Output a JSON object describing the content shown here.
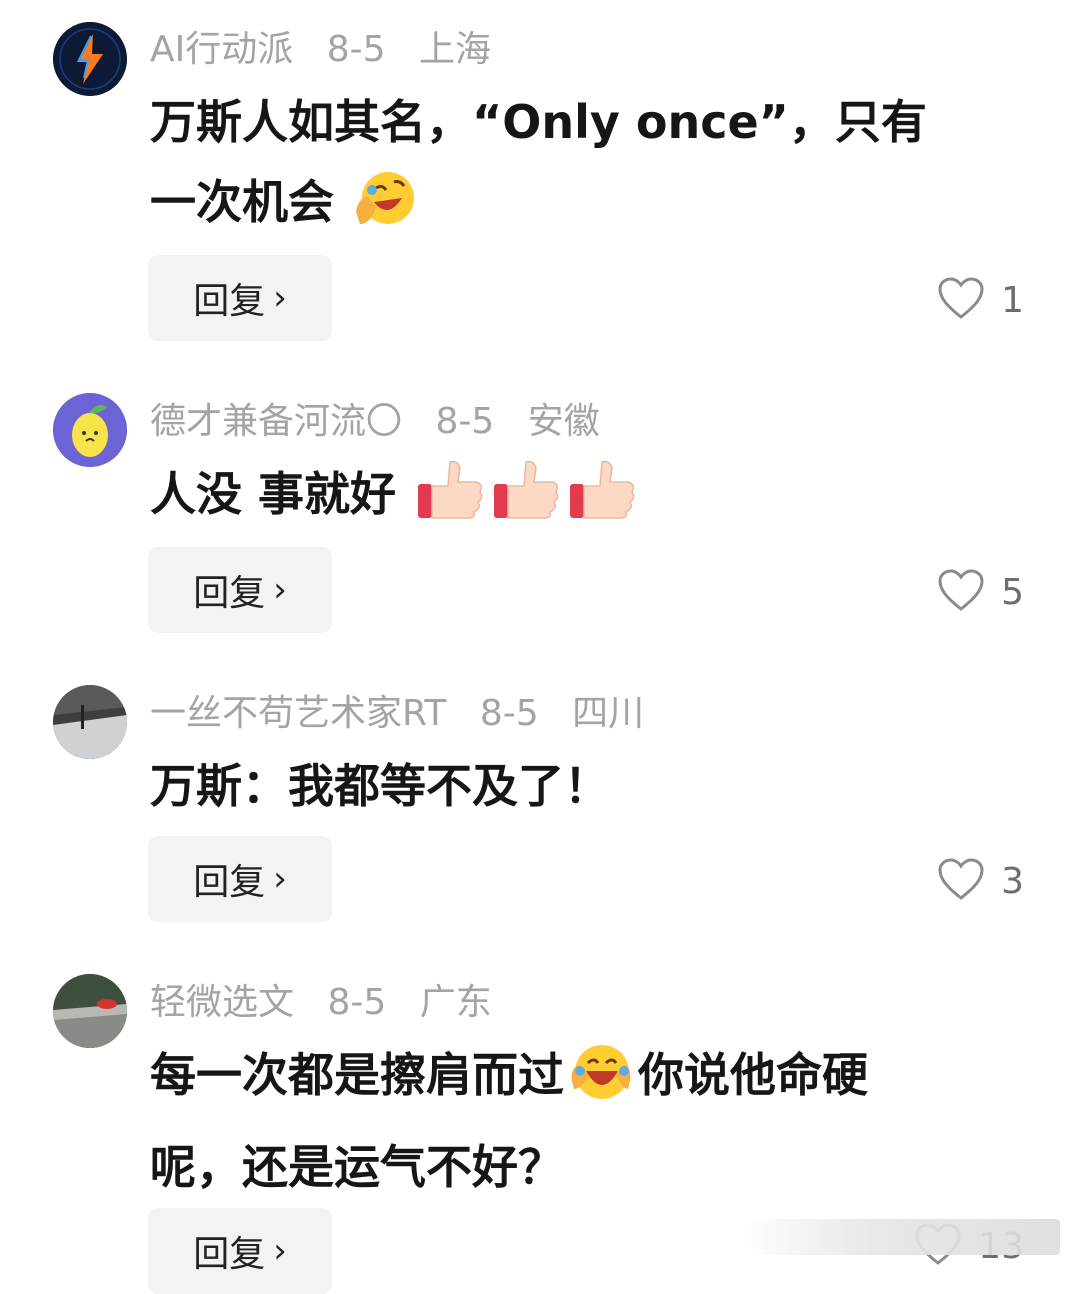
{
  "comments": [
    {
      "username": "AI行动派",
      "date": "8-5",
      "location": "上海",
      "text_line1": "万斯人如其名，“Only once”，只有",
      "text_line2": "一次机会",
      "emoji": "rolling-on-floor-laughing-emoji",
      "reply_label": "回复",
      "likes": "1"
    },
    {
      "username": "德才兼备河流〇",
      "date": "8-5",
      "location": "安徽",
      "text_line1": "人没 事就好",
      "emoji": "thumbs-up-emoji",
      "reply_label": "回复",
      "likes": "5"
    },
    {
      "username": "一丝不苟艺术家RT",
      "date": "8-5",
      "location": "四川",
      "text_line1": "万斯：我都等不及了！",
      "reply_label": "回复",
      "likes": "3"
    },
    {
      "username": "轻微选文",
      "date": "8-5",
      "location": "广东",
      "text_line1_a": "每一次都是擦肩而过",
      "text_line1_b": "你说他命硬",
      "text_line2": "呢，还是运气不好？",
      "emoji": "laughing-crying-emoji",
      "reply_label": "回复",
      "likes": "13"
    }
  ],
  "colors": {
    "meta": "#a3a3a8",
    "text": "#161616",
    "reply_bg": "#f3f3f4",
    "like_icon": "#8a8a8f"
  }
}
